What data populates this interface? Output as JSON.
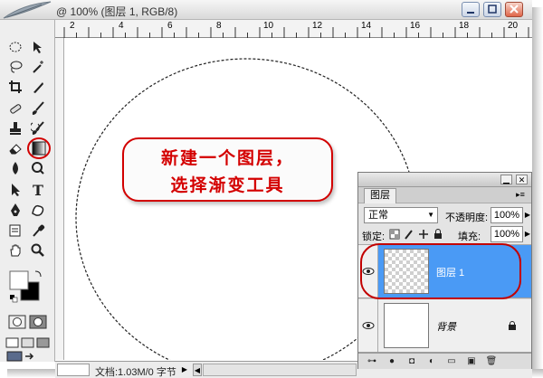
{
  "window": {
    "title": "@ 100% (图层 1, RGB/8)"
  },
  "ruler": {
    "ticks": [
      "2",
      "4",
      "6",
      "8",
      "10",
      "12",
      "14",
      "16",
      "18",
      "20"
    ]
  },
  "callout": {
    "line1": "新建一个图层，",
    "line2": "选择渐变工具"
  },
  "status": {
    "doc_size": "文档:1.03M/0 字节"
  },
  "layers_panel": {
    "tab_label": "图层",
    "blend_mode": "正常",
    "opacity_label": "不透明度:",
    "opacity_value": "100%",
    "lock_label": "锁定:",
    "fill_label": "填充:",
    "fill_value": "100%",
    "layers": [
      {
        "name": "图层 1",
        "selected": true
      },
      {
        "name": "背景",
        "selected": false,
        "locked": true
      }
    ]
  },
  "colors": {
    "accent_red": "#d40000",
    "selected_layer": "#4a9af5"
  },
  "icons": {
    "window_controls": [
      "minimize-icon",
      "maximize-icon",
      "close-icon"
    ],
    "tools": [
      "marquee-tool-icon",
      "move-tool-icon",
      "lasso-tool-icon",
      "magic-wand-tool-icon",
      "crop-tool-icon",
      "slice-tool-icon",
      "healing-brush-tool-icon",
      "brush-tool-icon",
      "clone-stamp-tool-icon",
      "history-brush-tool-icon",
      "eraser-tool-icon",
      "gradient-tool-icon",
      "blur-tool-icon",
      "dodge-tool-icon",
      "path-selection-tool-icon",
      "type-tool-icon",
      "pen-tool-icon",
      "shape-tool-icon",
      "notes-tool-icon",
      "eyedropper-tool-icon",
      "hand-tool-icon",
      "zoom-tool-icon"
    ]
  }
}
